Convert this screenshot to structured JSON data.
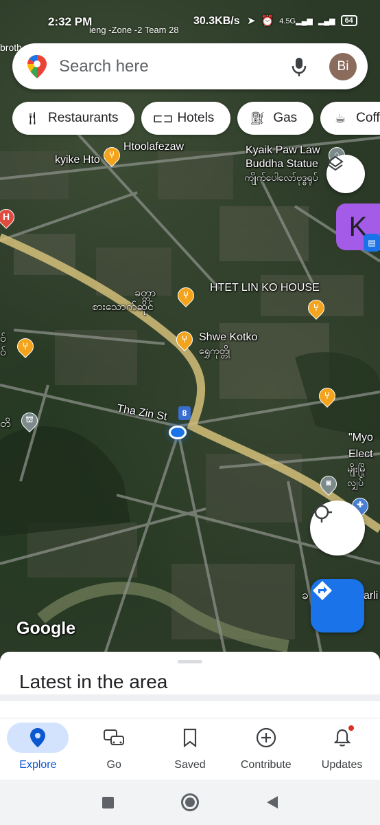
{
  "status_bar": {
    "time": "2:32 PM",
    "network_speed": "30.3KB/s",
    "network_type": "4.5G",
    "battery": "64",
    "notification_text": "ieng -Zone -2 Team 28"
  },
  "search": {
    "placeholder": "Search here",
    "avatar_initials": "Bi",
    "avatar_color": "#8b6b5c"
  },
  "chips": [
    {
      "label": "Restaurants",
      "icon": "fork-knife-icon"
    },
    {
      "label": "Hotels",
      "icon": "bed-icon"
    },
    {
      "label": "Gas",
      "icon": "gas-pump-icon"
    },
    {
      "label": "Coffee",
      "icon": "coffee-icon"
    }
  ],
  "map": {
    "labels": {
      "top_left_partial": "broth",
      "htoolafezaw": "Htoolafezaw",
      "kyike_hto": "kyike Hto",
      "buddha_statue_en1": "Kyaik Paw Law",
      "buddha_statue_en2": "Buddha Statue",
      "buddha_statue_my": "ကျိုက်ပေါလော်ဗုဒ္ဓရုပ်",
      "htet_lin_ko": "HTET LIN KO HOUSE",
      "burmese_restaurant_1": "ခတ္တာ",
      "burmese_restaurant_2": "စားသောက်ဆိုင်",
      "shwe_kotko_en": "Shwe Kotko",
      "shwe_kotko_my": "ရွှေကုတ္တို",
      "left_partial_1": "ဝ်",
      "left_partial_2": "ဝ်",
      "left_partial_3": "တိ",
      "street": "Tha Zin St",
      "route_number": "8",
      "myo_partial": "\"Myo",
      "elect_partial": "Elect",
      "myo_burmese_1": "မျိုးမြို",
      "myo_burmese_2": "လျှပ်",
      "bottom_right_partial": "arli",
      "bottom_right_char": "ခ"
    },
    "watermark": "Google",
    "messenger_bubble_letter": "K"
  },
  "sheet": {
    "title": "Latest in the area"
  },
  "bottom_nav": [
    {
      "label": "Explore",
      "icon": "location-pin-icon",
      "active": true
    },
    {
      "label": "Go",
      "icon": "car-transit-icon",
      "active": false
    },
    {
      "label": "Saved",
      "icon": "bookmark-icon",
      "active": false
    },
    {
      "label": "Contribute",
      "icon": "plus-circle-icon",
      "active": false
    },
    {
      "label": "Updates",
      "icon": "bell-icon",
      "active": false,
      "has_badge": true
    }
  ],
  "colors": {
    "accent": "#1a73e8",
    "active_nav_bg": "#d3e3fd",
    "poi_orange": "#f3a31c",
    "road_yellow": "#d4c07a"
  }
}
